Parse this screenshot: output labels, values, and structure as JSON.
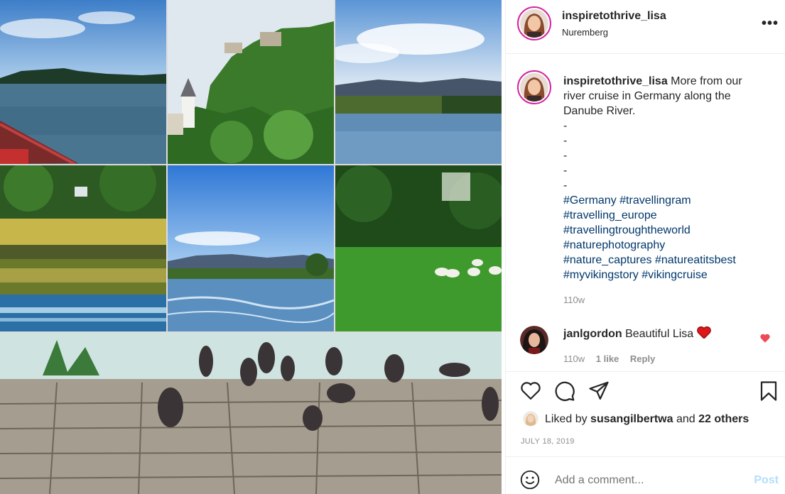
{
  "post": {
    "username": "inspiretothrive_lisa",
    "location": "Nuremberg",
    "more_icon": "more-horizontal-icon",
    "caption": {
      "username": "inspiretothrive_lisa",
      "text": "More from our river cruise in Germany along the Danube River.",
      "dashes": [
        "-",
        "-",
        "-",
        "-",
        "-"
      ],
      "hashtag_lines": [
        "#Germany #travellingram",
        "#travelling_europe",
        "#travellingtroughtheworld",
        "#naturephotography",
        "#nature_captures #natureatitsbest",
        "#myvikingstory #vikingcruise"
      ],
      "age": "110w"
    },
    "comment": {
      "username": "janlgordon",
      "text": "Beautiful Lisa",
      "emoji": "❤️",
      "age": "110w",
      "likes": "1 like",
      "reply": "Reply"
    },
    "likes": {
      "prefix": "Liked by",
      "user": "susangilbertwa",
      "middle": "and",
      "others": "22 others"
    },
    "date": "JULY 18, 2019",
    "add_comment_placeholder": "Add a comment...",
    "post_label": "Post"
  },
  "colors": {
    "hashtag": "#00376b",
    "like_red": "#ed4956",
    "post_button": "#b2dffc",
    "ring": "#d6249f"
  }
}
